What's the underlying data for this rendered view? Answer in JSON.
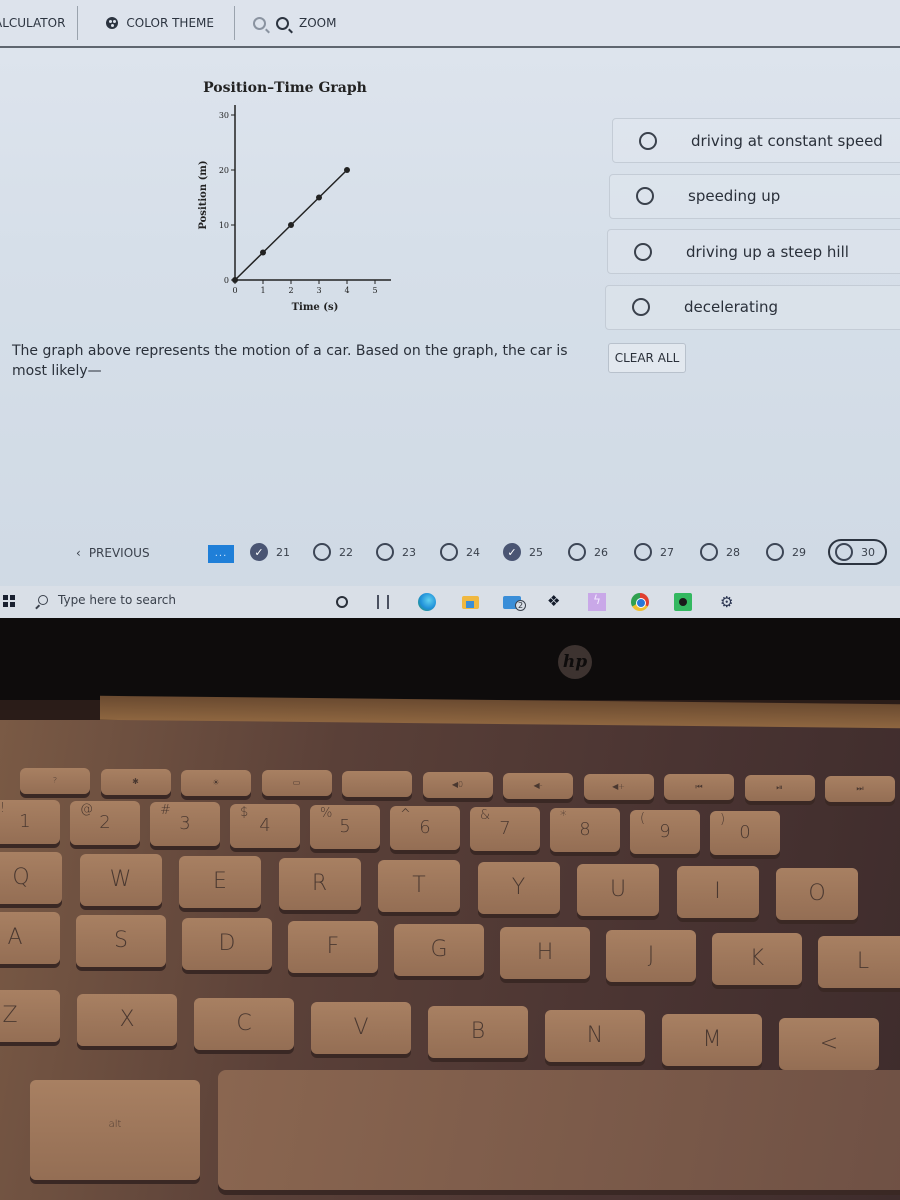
{
  "toolbar": {
    "calculator_label": "ALCULATOR",
    "color_theme_label": "COLOR THEME",
    "zoom_label": "ZOOM",
    "icons": [
      "palette-icon",
      "zoom-out-icon",
      "zoom-in-icon"
    ]
  },
  "question": {
    "text": "The graph above represents the motion of a car. Based on the graph, the car is most likely—",
    "options": [
      {
        "label": "driving at constant speed",
        "selected": false
      },
      {
        "label": "speeding up",
        "selected": false
      },
      {
        "label": "driving up a steep hill",
        "selected": false
      },
      {
        "label": "decelerating",
        "selected": false
      }
    ],
    "clear_all_label": "CLEAR ALL"
  },
  "chart_data": {
    "type": "line",
    "title": "Position–Time Graph",
    "xlabel": "Time (s)",
    "ylabel": "Position (m)",
    "x": [
      0,
      1,
      2,
      3,
      4
    ],
    "series": [
      {
        "name": "Position",
        "values": [
          0,
          5,
          10,
          15,
          20
        ],
        "markers": true
      }
    ],
    "xlim": [
      0,
      5
    ],
    "ylim": [
      0,
      30
    ],
    "xticks": [
      0,
      1,
      2,
      3,
      4,
      5
    ],
    "yticks": [
      0,
      10,
      20,
      30
    ],
    "grid": false,
    "legend": "none"
  },
  "nav": {
    "previous_label": "PREVIOUS",
    "more_label": "...",
    "questions": [
      {
        "num": "21",
        "status": "answered"
      },
      {
        "num": "22",
        "status": "unanswered"
      },
      {
        "num": "23",
        "status": "unanswered"
      },
      {
        "num": "24",
        "status": "unanswered"
      },
      {
        "num": "25",
        "status": "answered"
      },
      {
        "num": "26",
        "status": "unanswered"
      },
      {
        "num": "27",
        "status": "unanswered"
      },
      {
        "num": "28",
        "status": "unanswered"
      },
      {
        "num": "29",
        "status": "unanswered"
      },
      {
        "num": "30",
        "status": "current"
      }
    ]
  },
  "taskbar": {
    "search_placeholder": "Type here to search",
    "mail_badge": "2",
    "apps": [
      "cortana",
      "task-view",
      "edge",
      "file-explorer",
      "mail",
      "dropbox",
      "power-automate",
      "chrome",
      "spotify",
      "settings"
    ]
  },
  "laptop": {
    "brand": "hp",
    "fn_row": [
      "?",
      "✱",
      "☀",
      "▭",
      "",
      "◀0",
      "◀-",
      "◀+",
      "⏮",
      "⏯",
      "⏭"
    ],
    "num_row": [
      {
        "main": "1",
        "top": "!"
      },
      {
        "main": "2",
        "top": "@"
      },
      {
        "main": "3",
        "top": "#"
      },
      {
        "main": "4",
        "top": "$"
      },
      {
        "main": "5",
        "top": "%"
      },
      {
        "main": "6",
        "top": "^"
      },
      {
        "main": "7",
        "top": "&"
      },
      {
        "main": "8",
        "top": "*"
      },
      {
        "main": "9",
        "top": "("
      },
      {
        "main": "0",
        "top": ")"
      }
    ],
    "row_q": [
      "Q",
      "W",
      "E",
      "R",
      "T",
      "Y",
      "U",
      "I",
      "O"
    ],
    "row_a": [
      "A",
      "S",
      "D",
      "F",
      "G",
      "H",
      "J",
      "K",
      "L"
    ],
    "row_z": [
      "Z",
      "X",
      "C",
      "V",
      "B",
      "N",
      "M",
      "<"
    ],
    "alt_label": "alt"
  }
}
